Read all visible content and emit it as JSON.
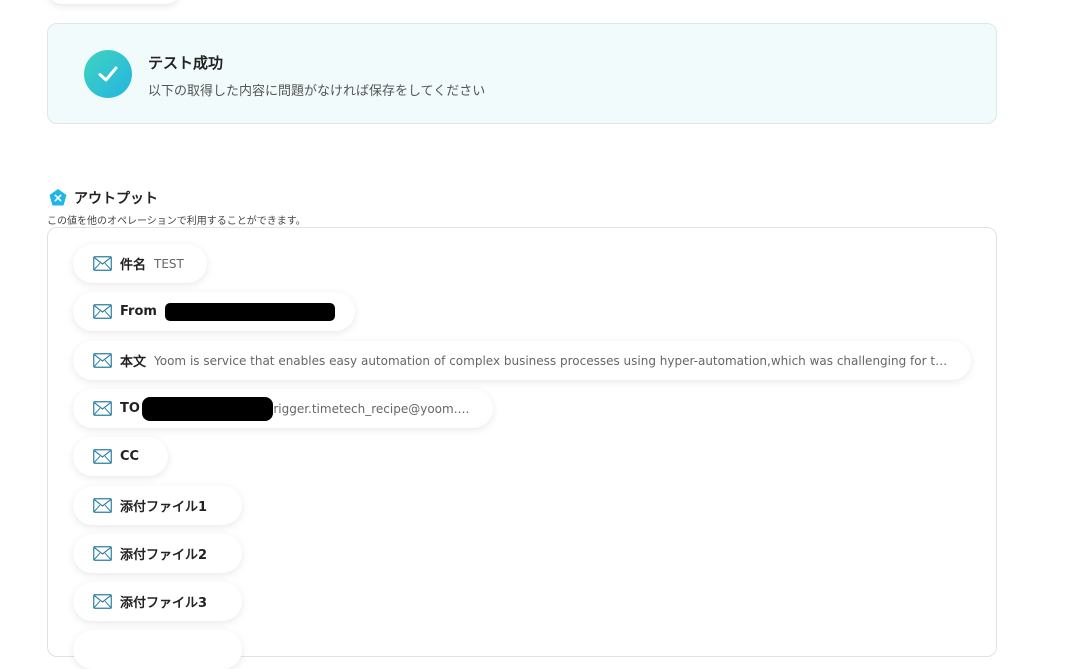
{
  "success": {
    "title": "テスト成功",
    "subtitle": "以下の取得した内容に問題がなければ保存をしてください"
  },
  "output": {
    "title": "アウトプット",
    "description": "この値を他のオペレーションで利用することができます。",
    "icon": "x-badge-icon",
    "items": [
      {
        "label": "件名",
        "value": "TEST"
      },
      {
        "label": "From",
        "value": ""
      },
      {
        "label": "本文",
        "value": "Yoom is service that enables easy automation of complex business processes using hyper-automation,which was challenging for traditional automation tools"
      },
      {
        "label": "TO",
        "value": "rigger.timetech_recipe@yoom.fun"
      },
      {
        "label": "CC",
        "value": ""
      },
      {
        "label": "添付ファイル1",
        "value": ""
      },
      {
        "label": "添付ファイル2",
        "value": ""
      },
      {
        "label": "添付ファイル3",
        "value": ""
      }
    ]
  },
  "colors": {
    "accent_start": "#3fd3c0",
    "accent_end": "#25b5e0",
    "card_bg": "#f2fbfb",
    "icon_stroke": "#2a7fa3"
  }
}
